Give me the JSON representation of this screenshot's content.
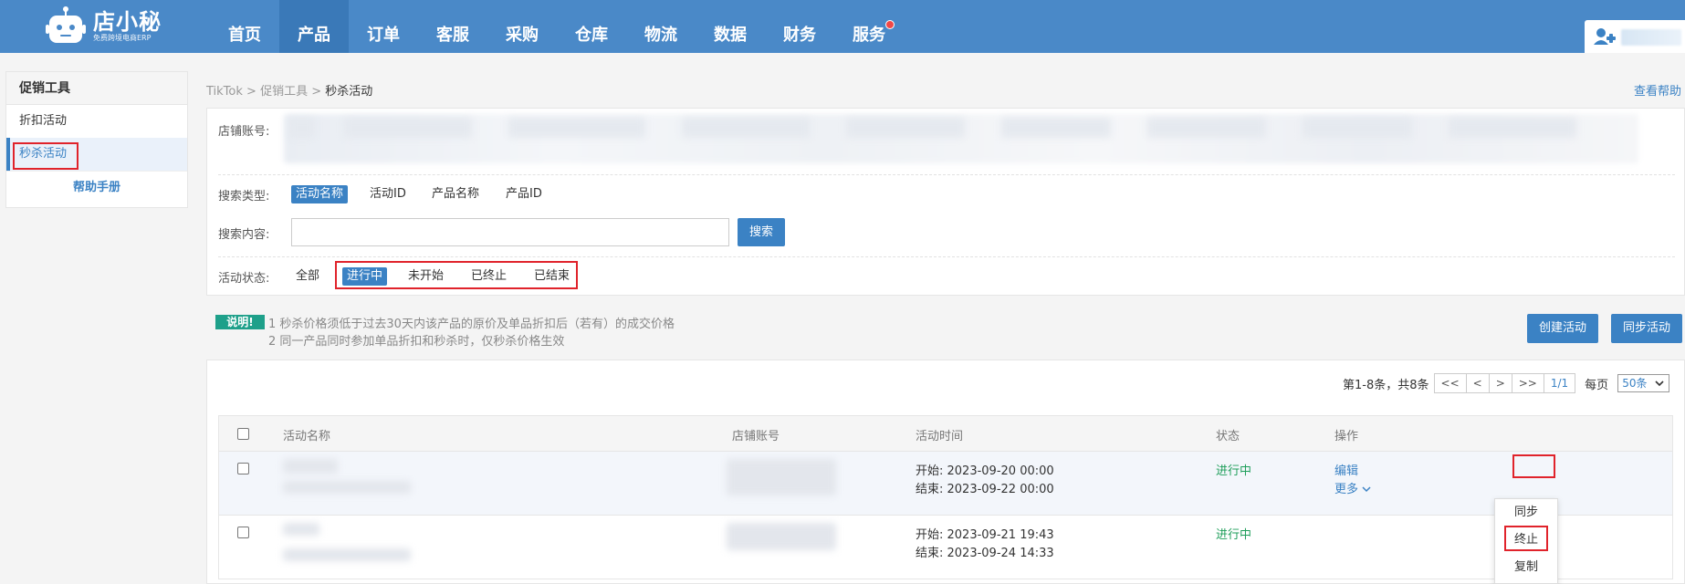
{
  "logo": {
    "title": "店小秘",
    "subtitle": "免费跨境电商ERP"
  },
  "nav": [
    {
      "label": "首页"
    },
    {
      "label": "产品",
      "active": true
    },
    {
      "label": "订单"
    },
    {
      "label": "客服"
    },
    {
      "label": "采购"
    },
    {
      "label": "仓库"
    },
    {
      "label": "物流"
    },
    {
      "label": "数据"
    },
    {
      "label": "财务"
    },
    {
      "label": "服务",
      "badge": true
    }
  ],
  "sidebar": {
    "title": "促销工具",
    "items": [
      {
        "label": "折扣活动"
      },
      {
        "label": "秒杀活动",
        "active": true
      }
    ],
    "help": "帮助手册"
  },
  "breadcrumb": {
    "root": "TikTok",
    "sep": ">",
    "parent": "促销工具",
    "current": "秒杀活动"
  },
  "help_link": "查看帮助",
  "filters": {
    "shop_label": "店铺账号:",
    "search_type_label": "搜索类型:",
    "search_types": [
      "活动名称",
      "活动ID",
      "产品名称",
      "产品ID"
    ],
    "search_content_label": "搜索内容:",
    "search_value": "",
    "search_button": "搜索",
    "status_label": "活动状态:",
    "statuses": [
      "全部",
      "进行中",
      "未开始",
      "已终止",
      "已结束"
    ]
  },
  "notice": {
    "tag": "说明!",
    "line1": "1 秒杀价格须低于过去30天内该产品的原价及单品折扣后（若有）的成交价格",
    "line2": "2 同一产品同时参加单品折扣和秒杀时，仅秒杀价格生效"
  },
  "actions": {
    "create": "创建活动",
    "sync": "同步活动"
  },
  "pager": {
    "summary": "第1-8条，共8条",
    "first": "<<",
    "prev": "<",
    "next": ">",
    "last": ">>",
    "page": "1/1",
    "per_page_label": "每页",
    "per_page": "50条"
  },
  "table": {
    "headers": {
      "name": "活动名称",
      "shop": "店铺账号",
      "time": "活动时间",
      "status": "状态",
      "ops": "操作"
    },
    "rows": [
      {
        "start": "开始: 2023-09-20 00:00",
        "end": "结束: 2023-09-22 00:00",
        "status": "进行中",
        "edit": "编辑",
        "more": "更多"
      },
      {
        "start": "开始: 2023-09-21 19:43",
        "end": "结束: 2023-09-24 14:33",
        "status": "进行中"
      }
    ]
  },
  "dropdown": [
    "同步",
    "终止",
    "复制"
  ]
}
